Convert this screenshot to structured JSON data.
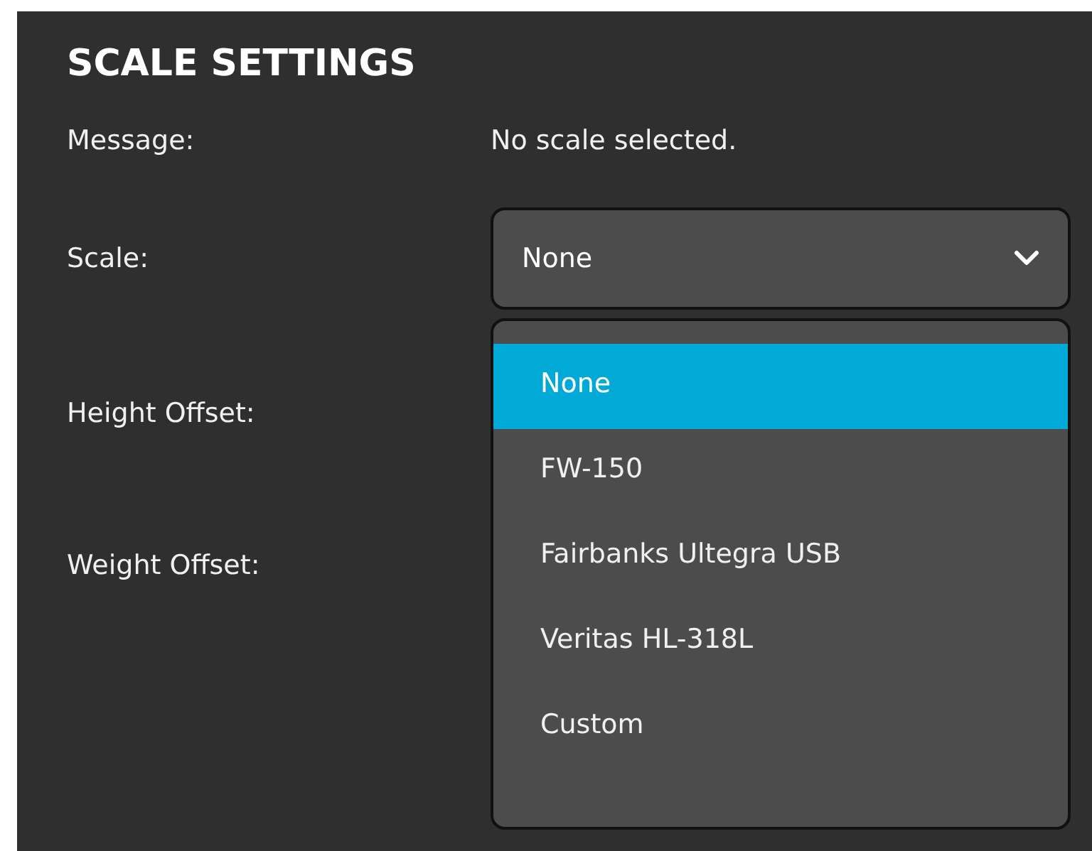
{
  "title": "SCALE SETTINGS",
  "message": {
    "label": "Message:",
    "value": "No scale selected."
  },
  "scale": {
    "label": "Scale:",
    "value": "None",
    "expanded": true,
    "options": [
      {
        "label": "None",
        "selected": true
      },
      {
        "label": "FW-150",
        "selected": false
      },
      {
        "label": "Fairbanks Ultegra USB",
        "selected": false
      },
      {
        "label": "Veritas HL-318L",
        "selected": false
      },
      {
        "label": "Custom",
        "selected": false
      }
    ]
  },
  "offsets": [
    {
      "label": "Height Offset:"
    },
    {
      "label": "Weight Offset:"
    }
  ]
}
